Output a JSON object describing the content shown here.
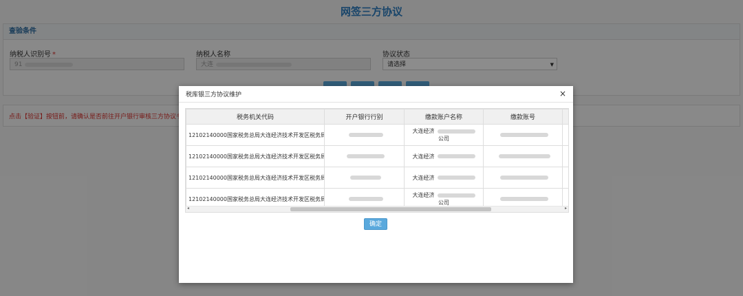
{
  "page": {
    "title": "网签三方协议"
  },
  "query": {
    "section_title": "查验条件",
    "taxpayer_id_label": "纳税人识别号",
    "required_mark": "*",
    "taxpayer_id_prefix": "91",
    "taxpayer_name_label": "纳税人名称",
    "taxpayer_name_prefix": "大连",
    "agreement_status_label": "协议状态",
    "agreement_status_value": "请选择"
  },
  "notice": "点击【验证】按钮前，请确认是否前往开户银行审核三方协议书！",
  "modal": {
    "title": "税库银三方协议维护",
    "close": "×",
    "columns": [
      "税务机关代码",
      "开户银行行别",
      "缴款账户名称",
      "缴款账号"
    ],
    "rows": [
      {
        "tax_office": "12102140000国家税务总局大连经济技术开发区税务局",
        "account_name_line1": "大连经济",
        "account_name_line2": "公司"
      },
      {
        "tax_office": "12102140000国家税务总局大连经济技术开发区税务局",
        "account_name_line1": "大连经济",
        "account_name_line2": ""
      },
      {
        "tax_office": "12102140000国家税务总局大连经济技术开发区税务局",
        "account_name_line1": "大连经济",
        "account_name_line2": ""
      },
      {
        "tax_office": "12102140000国家税务总局大连经济技术开发区税务局",
        "account_name_line1": "大连经济",
        "account_name_line2": "公司"
      }
    ],
    "scroll_left": "◂",
    "scroll_right": "▸",
    "confirm_label": "确定"
  }
}
